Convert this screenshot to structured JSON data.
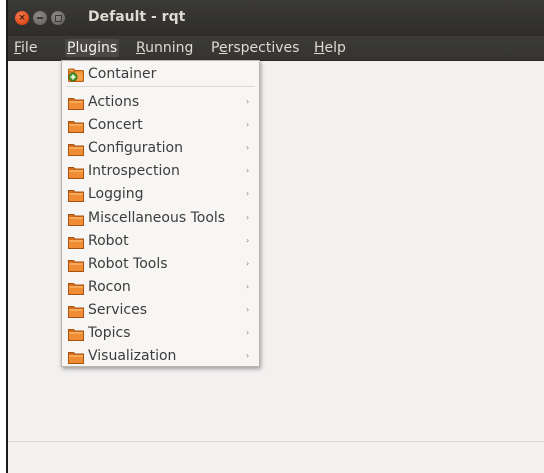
{
  "window": {
    "title": "Default - rqt"
  },
  "menubar": {
    "items": [
      {
        "label": "File",
        "mnemonic": "F"
      },
      {
        "label": "Plugins",
        "mnemonic": "P"
      },
      {
        "label": "Running",
        "mnemonic": "R"
      },
      {
        "label": "Perspectives",
        "mnemonic": "e"
      },
      {
        "label": "Help",
        "mnemonic": "H"
      }
    ],
    "active": "Plugins"
  },
  "plugins_menu": {
    "top_item": {
      "label": "Container",
      "icon": "container-add-icon"
    },
    "submenus": [
      {
        "label": "Actions",
        "icon": "folder-icon",
        "has_submenu": true
      },
      {
        "label": "Concert",
        "icon": "folder-icon",
        "has_submenu": true
      },
      {
        "label": "Configuration",
        "icon": "folder-icon",
        "has_submenu": true
      },
      {
        "label": "Introspection",
        "icon": "folder-icon",
        "has_submenu": true
      },
      {
        "label": "Logging",
        "icon": "folder-icon",
        "has_submenu": true
      },
      {
        "label": "Miscellaneous Tools",
        "icon": "folder-icon",
        "has_submenu": true
      },
      {
        "label": "Robot",
        "icon": "folder-icon",
        "has_submenu": true
      },
      {
        "label": "Robot Tools",
        "icon": "folder-icon",
        "has_submenu": true
      },
      {
        "label": "Rocon",
        "icon": "folder-icon",
        "has_submenu": true
      },
      {
        "label": "Services",
        "icon": "folder-icon",
        "has_submenu": true
      },
      {
        "label": "Topics",
        "icon": "folder-icon",
        "has_submenu": true
      },
      {
        "label": "Visualization",
        "icon": "folder-icon",
        "has_submenu": true
      }
    ],
    "submenu_arrow": "›"
  },
  "colors": {
    "titlebar": "#3b3a36",
    "close_button": "#df4a16",
    "folder": "#e9852a",
    "menu_bg": "#f7f6f4"
  }
}
